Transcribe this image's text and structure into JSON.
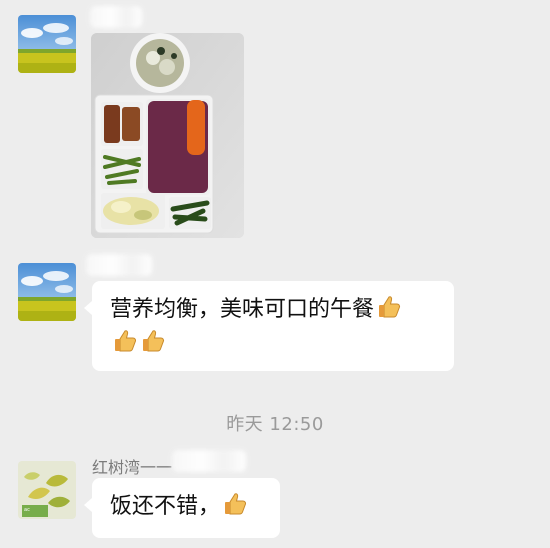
{
  "messages": [
    {
      "type": "image",
      "avatar": "landscape-field-avatar",
      "content": "photo of boxed lunch with rice, vegetables, soup"
    },
    {
      "type": "text",
      "avatar": "landscape-field-avatar",
      "line1": "营养均衡，美味可口的午餐",
      "emoji": "thumbs-up-icon"
    }
  ],
  "timestamp": "昨天 12:50",
  "third_message": {
    "sender": "红树湾一一",
    "text": "饭还不错，",
    "emoji": "thumbs-up-icon"
  },
  "colors": {
    "background": "#ededed",
    "bubble": "#ffffff",
    "timestamp": "#9a9a9a",
    "sender": "#7b7b7b"
  }
}
